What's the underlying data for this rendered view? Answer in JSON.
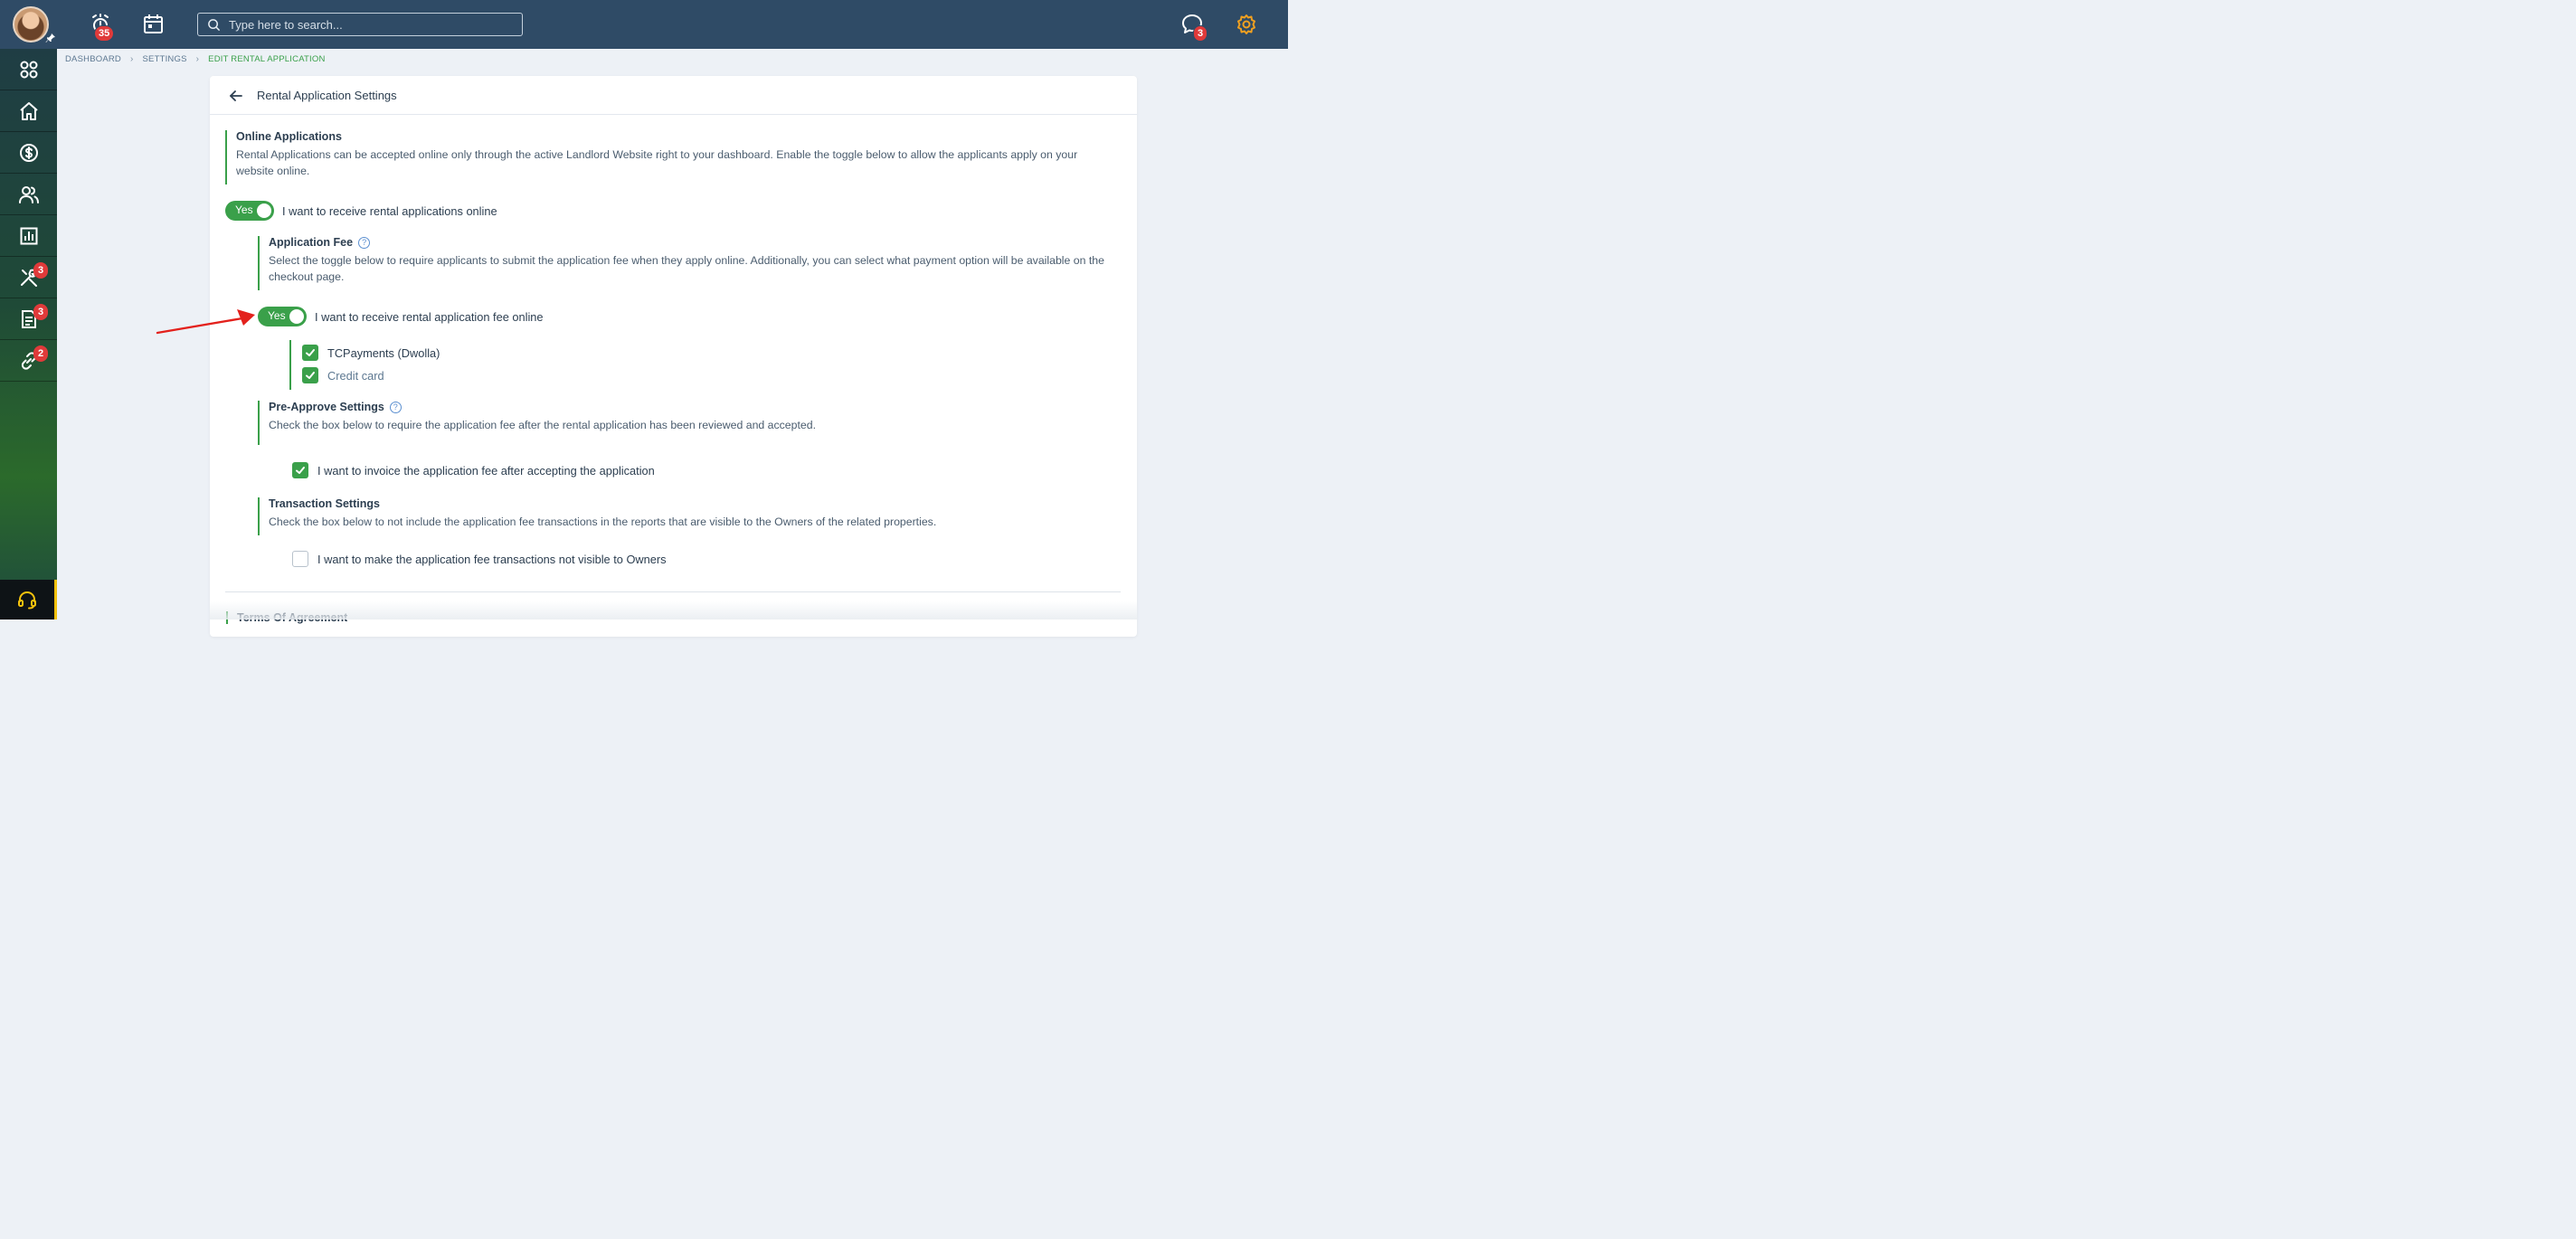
{
  "topbar": {
    "alerts_badge": "35",
    "messages_badge": "3",
    "search": {
      "placeholder": "Type here to search..."
    },
    "icons": [
      "avatar",
      "pin-icon",
      "alarm-icon",
      "calendar-icon",
      "search-icon",
      "chat-icon",
      "gear-icon"
    ],
    "colors": {
      "bar": "#2f4b66",
      "gear": "#f0a020",
      "badge": "#e03a3a"
    }
  },
  "sidebar": {
    "items": [
      {
        "name": "dashboard-grid-icon",
        "badge": ""
      },
      {
        "name": "home-icon",
        "badge": ""
      },
      {
        "name": "dollar-icon",
        "badge": ""
      },
      {
        "name": "users-icon",
        "badge": ""
      },
      {
        "name": "reports-chart-icon",
        "badge": ""
      },
      {
        "name": "tools-icon",
        "badge": "3"
      },
      {
        "name": "document-icon",
        "badge": "3"
      },
      {
        "name": "link-icon",
        "badge": "2"
      }
    ],
    "support_icon": "headset-icon"
  },
  "breadcrumb": {
    "items": [
      "DASHBOARD",
      "SETTINGS",
      "EDIT RENTAL APPLICATION"
    ]
  },
  "page": {
    "title": "Rental Application Settings",
    "online": {
      "title": "Online Applications",
      "description": "Rental Applications can be accepted online only through the active Landlord Website right to your dashboard. Enable the toggle below to allow the applicants apply on your website online.",
      "toggle_label": "Yes",
      "toggle_on": true,
      "toggle_text": "I want to receive rental applications online"
    },
    "fee": {
      "title": "Application Fee",
      "description": "Select the toggle below to require applicants to submit the application fee when they apply online. Additionally, you can select what payment option will be available on the checkout page.",
      "toggle_label": "Yes",
      "toggle_on": true,
      "toggle_text": "I want to receive rental application fee online",
      "options": [
        {
          "label": "TCPayments (Dwolla)",
          "checked": true
        },
        {
          "label": "Credit card",
          "checked": true
        }
      ]
    },
    "preapprove": {
      "title": "Pre-Approve Settings",
      "description": "Check the box below to require the application fee after the rental application has been reviewed and accepted.",
      "check_label": "I want to invoice the application fee after accepting the application",
      "checked": true
    },
    "transaction": {
      "title": "Transaction Settings",
      "description": "Check the box below to not include the application fee transactions in the reports that are visible to the Owners of the related properties.",
      "check_label": "I want to make the application fee transactions not visible to Owners",
      "checked": false
    },
    "terms": {
      "title": "Terms Of Agreement"
    }
  },
  "theme": {
    "accent": "#3aa04a",
    "annotation_arrow": "#e3211c"
  }
}
